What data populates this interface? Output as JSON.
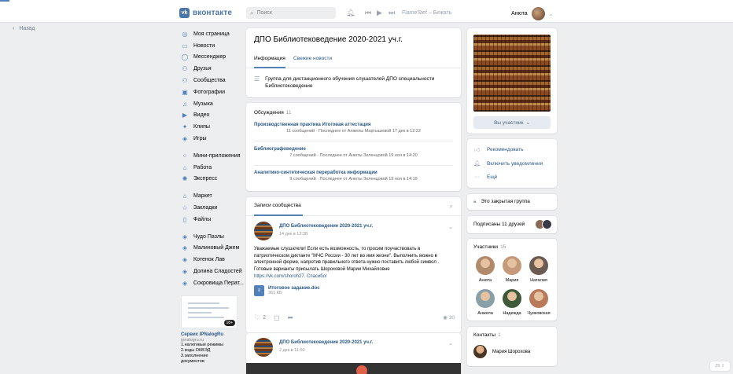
{
  "header": {
    "logo_letters": "vk",
    "logo_text": "вконтакте",
    "search_placeholder": "Поиск",
    "player_text": "FlameStef – Бежать",
    "user_name": "Анюта"
  },
  "back_label": "Назад",
  "nav": {
    "items": [
      {
        "label": "Моя страница",
        "icon": "user-circle-icon"
      },
      {
        "label": "Новости",
        "icon": "news-icon"
      },
      {
        "label": "Мессенджер",
        "icon": "chat-icon"
      },
      {
        "label": "Друзья",
        "icon": "friends-icon"
      },
      {
        "label": "Сообщества",
        "icon": "communities-icon"
      },
      {
        "label": "Фотографии",
        "icon": "photo-icon"
      },
      {
        "label": "Музыка",
        "icon": "music-icon"
      },
      {
        "label": "Видео",
        "icon": "video-icon"
      },
      {
        "label": "Клипы",
        "icon": "clips-icon"
      },
      {
        "label": "Игры",
        "icon": "games-icon"
      }
    ],
    "items2": [
      {
        "label": "Мини-приложения",
        "icon": "apps-icon"
      },
      {
        "label": "Работа",
        "icon": "briefcase-icon"
      },
      {
        "label": "Экспресс",
        "icon": "express-icon"
      }
    ],
    "items3": [
      {
        "label": "Маркет",
        "icon": "market-icon"
      },
      {
        "label": "Закладки",
        "icon": "star-icon"
      },
      {
        "label": "Файлы",
        "icon": "file-icon"
      }
    ],
    "items4": [
      {
        "label": "Чудо Пазлы",
        "icon": "game-icon"
      },
      {
        "label": "Малиновый Джем",
        "icon": "game-icon"
      },
      {
        "label": "Котенок Лав",
        "icon": "game-icon"
      },
      {
        "label": "Долина Сладостей",
        "icon": "game-icon"
      },
      {
        "label": "Сокровища Перат...",
        "icon": "game-icon"
      }
    ]
  },
  "ad": {
    "badge": "18+",
    "title": "Сервис IPNalogRu",
    "source": "ipnalogru.ru",
    "lines": [
      "1.налоговые режимы",
      "2.коды ОКВЭД",
      "3.заполнение",
      "документов"
    ]
  },
  "group": {
    "title": "ДПО Библиотековедение 2020-2021 уч.г.",
    "tab_info": "Информация",
    "tab_news": "Свежие новости",
    "description": "Группа для дистанционного обучения слушателей ДПО специальности Библиотековедение"
  },
  "discussions": {
    "title": "Обсуждения",
    "count": "11",
    "topics": [
      {
        "title": "Производственная практика Итоговая аттестация",
        "meta": "11 сообщений · Последнее от Анжелы Мартышевой 17 дек в 12:22"
      },
      {
        "title": "Библиографоведение",
        "meta": "7 сообщений · Последнее от Анюты Зеленцовой 19 ноя в 14:20"
      },
      {
        "title": "Аналитико-синтетическая переработка информации",
        "meta": "9 сообщений · Последнее от Анюты Зеленцовой 19 ноя в 14:19"
      }
    ]
  },
  "wall": {
    "tab": "Записи сообщества",
    "post": {
      "author": "ДПО Библиотековедение 2020-2021 уч.г.",
      "date": "14 дек в 13:38",
      "text": "Уважаемые слушатели! Если есть возможность, то просим поучаствовать в патриотическом диктанте \"МЧС России - 30 лет во имя жизни\". Выполнить можно в электронной форме, напротив правильного ответа нужно поставить любой символ . Готовые варианты присылать Шороховой Марии Михайловне",
      "link": "https://vk.com/shoroh27",
      "link_suffix": ". Спасибо!",
      "doc_name": "Итоговое задание.doc",
      "doc_size": "361 КБ",
      "likes": "2",
      "views": "30"
    },
    "post2": {
      "author": "ДПО Библиотековедение 2020-2021 уч.г.",
      "date": "2 дек в 11:50"
    }
  },
  "right": {
    "member_button": "Вы участник",
    "actions": [
      "Рекомендовать",
      "Включить уведомления",
      "Ещё"
    ],
    "closed_group": "Это закрытая группа",
    "subscribed_friends": "Подписаны 11 друзей",
    "members_title": "Участники",
    "members_count": "15",
    "members": [
      {
        "name": "Анюта",
        "color": "#b08a6a"
      },
      {
        "name": "Мария",
        "color": "#c49a7a"
      },
      {
        "name": "Наталия",
        "color": "#6a5a52"
      },
      {
        "name": "Анжела",
        "color": "#8aa0a8"
      },
      {
        "name": "Надежда",
        "color": "#3e5a3a"
      },
      {
        "name": "Чуиковская",
        "color": "#b87a5a"
      }
    ],
    "contacts_title": "Контакты",
    "contacts_count": "1",
    "contact_name": "Мария Шорохова"
  },
  "zoom_label": "25 ⇧",
  "colors": {
    "accent": "#4a76a8",
    "link": "#2a5885",
    "bg": "#edeef0"
  }
}
